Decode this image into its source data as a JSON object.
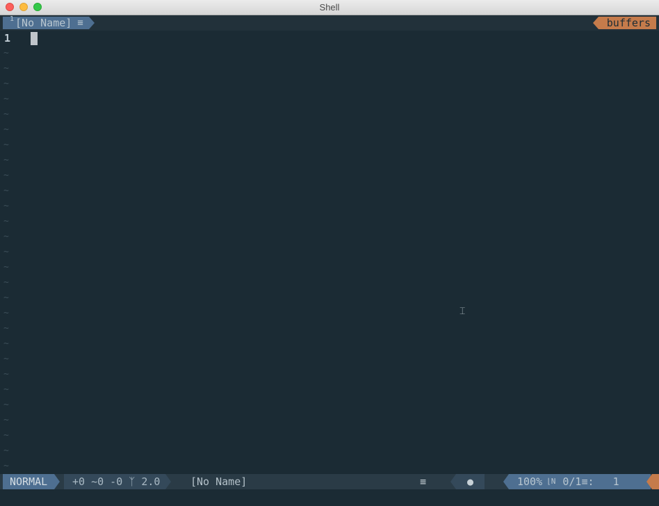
{
  "window": {
    "title": "Shell"
  },
  "tabline": {
    "tab_number": "1",
    "tab_label": "[No Name]",
    "tab_icon": "list-icon",
    "right_label": "buffers"
  },
  "buffer": {
    "line_number": "1",
    "tilde": "~",
    "empty_lines": 28
  },
  "statusline": {
    "mode": "NORMAL",
    "hunks": "+0 ~0 -0",
    "branch_icon": "git-branch-icon",
    "branch": "2.0",
    "filename": "[No Name]",
    "filetype_icon": "list-icon",
    "os_icon": "apple-icon",
    "percent": "100%",
    "ln_icon": "line-number-icon",
    "position": "0/1",
    "column_sep": ":",
    "column": "1"
  },
  "colors": {
    "background": "#1b2b34",
    "accent_blue": "#4e6f91",
    "accent_orange": "#c57b4b"
  }
}
